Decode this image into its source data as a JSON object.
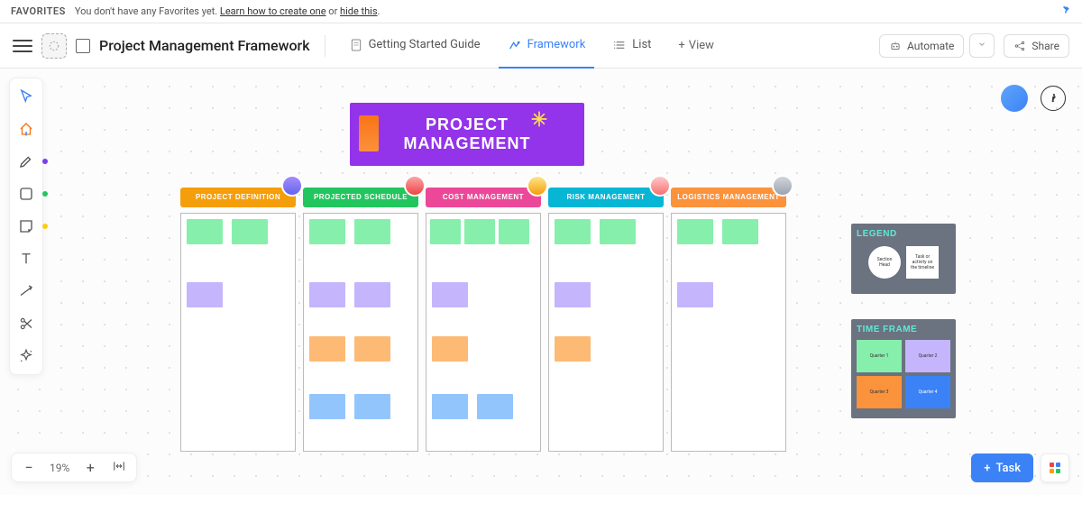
{
  "favorites": {
    "label": "FAVORITES",
    "message_pre": "You don't have any Favorites yet. ",
    "learn_link": "Learn how to create one",
    "message_mid": " or ",
    "hide_link": "hide this",
    "message_end": "."
  },
  "header": {
    "title": "Project Management Framework",
    "tabs": [
      {
        "label": "Getting Started Guide",
        "active": false
      },
      {
        "label": "Framework",
        "active": true
      },
      {
        "label": "List",
        "active": false
      }
    ],
    "view": "View",
    "automate": "Automate",
    "share": "Share"
  },
  "toolbar_tools": [
    "cursor",
    "home",
    "pen",
    "shape",
    "sticky",
    "text",
    "connector",
    "cut",
    "sparkle"
  ],
  "zoom": {
    "percent": "19%"
  },
  "banner": {
    "line1": "PROJECT",
    "line2": "MANAGEMENT"
  },
  "columns": [
    {
      "title": "PROJECT DEFINITION",
      "color": "#f59e0b"
    },
    {
      "title": "PROJECTED SCHEDULE",
      "color": "#22c55e"
    },
    {
      "title": "COST MANAGEMENT",
      "color": "#ec4899"
    },
    {
      "title": "RISK MANAGEMENT",
      "color": "#06b6d4"
    },
    {
      "title": "LOGISTICS MANAGEMENT",
      "color": "#fb923c"
    }
  ],
  "legend": {
    "title": "LEGEND",
    "circle": "Section Head",
    "square": "Task or activity on the timeline"
  },
  "timeframe": {
    "title": "TIME FRAME",
    "cells": [
      {
        "label": "Quarter 1",
        "color": "#86efac"
      },
      {
        "label": "Quarter 2",
        "color": "#c4b5fd"
      },
      {
        "label": "Quarter 3",
        "color": "#fb923c"
      },
      {
        "label": "Quarter 4",
        "color": "#3b82f6"
      }
    ]
  },
  "task_button": "Task"
}
